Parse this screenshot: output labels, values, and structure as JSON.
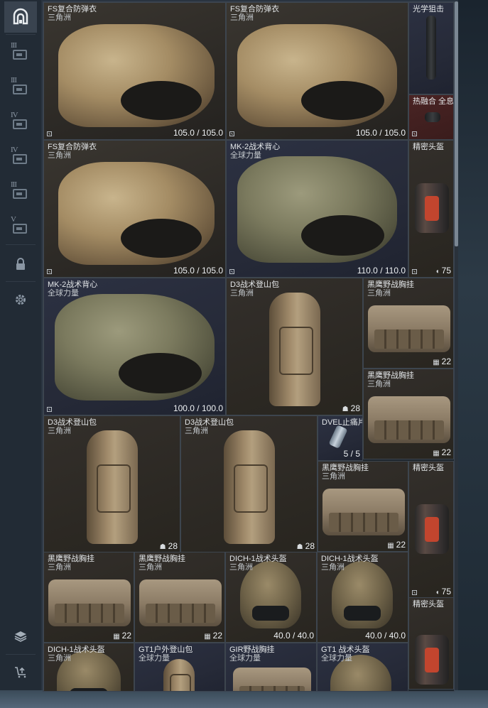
{
  "sidebar": {
    "home_icon": "home-arch-icon",
    "filters": [
      {
        "level": "III",
        "icon": "vest-filter-icon"
      },
      {
        "level": "III",
        "icon": "helmet-filter-icon"
      },
      {
        "level": "IV",
        "icon": "vest-filter-icon"
      },
      {
        "level": "IV",
        "icon": "helmet-filter-icon"
      },
      {
        "level": "III",
        "icon": "rig-filter-icon"
      },
      {
        "level": "V",
        "icon": "rig-filter-icon"
      }
    ],
    "lock_icon": "lock-icon",
    "settings_icon": "gear-icon",
    "layers_icon": "layers-icon",
    "sell_icon": "cart-upload-icon"
  },
  "items": [
    {
      "name": "FS复合防弹衣",
      "sub": "三角洲",
      "value": "105.0 / 105.0"
    },
    {
      "name": "FS复合防弹衣",
      "sub": "三角洲",
      "value": "105.0 / 105.0"
    },
    {
      "name": "光学狙击",
      "sub": "",
      "value": ""
    },
    {
      "name": "热融合 全息",
      "sub": "",
      "value": ""
    },
    {
      "name": "FS复合防弹衣",
      "sub": "三角洲",
      "value": "105.0 / 105.0"
    },
    {
      "name": "MK-2战术背心",
      "sub": "全球力量",
      "value": "110.0 / 110.0"
    },
    {
      "name": "精密头盔",
      "sub": "",
      "value": "75"
    },
    {
      "name": "MK-2战术背心",
      "sub": "全球力量",
      "value": "100.0 / 100.0"
    },
    {
      "name": "D3战术登山包",
      "sub": "三角洲",
      "value": "28"
    },
    {
      "name": "黑鹰野战胸挂",
      "sub": "三角洲",
      "value": "22"
    },
    {
      "name": "黑鹰野战胸挂",
      "sub": "三角洲",
      "value": "22"
    },
    {
      "name": "D3战术登山包",
      "sub": "三角洲",
      "value": "28"
    },
    {
      "name": "D3战术登山包",
      "sub": "三角洲",
      "value": "28"
    },
    {
      "name": "DVEL止痛片",
      "sub": "",
      "value": "5 / 5"
    },
    {
      "name": "黑鹰野战胸挂",
      "sub": "三角洲",
      "value": "22"
    },
    {
      "name": "精密头盔",
      "sub": "",
      "value": "75"
    },
    {
      "name": "黑鹰野战胸挂",
      "sub": "三角洲",
      "value": "22"
    },
    {
      "name": "黑鹰野战胸挂",
      "sub": "三角洲",
      "value": "22"
    },
    {
      "name": "DICH-1战术头盔",
      "sub": "三角洲",
      "value": "40.0 / 40.0"
    },
    {
      "name": "DICH-1战术头盔",
      "sub": "三角洲",
      "value": "40.0 / 40.0"
    },
    {
      "name": "精密头盔",
      "sub": "",
      "value": ""
    },
    {
      "name": "DICH-1战术头盔",
      "sub": "三角洲",
      "value": ""
    },
    {
      "name": "GT1户外登山包",
      "sub": "全球力量",
      "value": ""
    },
    {
      "name": "GIR野战胸挂",
      "sub": "全球力量",
      "value": ""
    },
    {
      "name": "GT1 战术头盔",
      "sub": "全球力量",
      "value": ""
    }
  ],
  "colors": {
    "accent": "#7b8793",
    "cell_border": "#3d454e",
    "sidebar_bg": "#222b35"
  }
}
